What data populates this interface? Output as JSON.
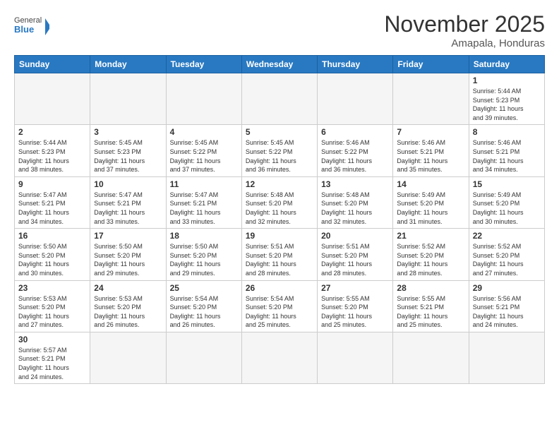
{
  "header": {
    "logo_general": "General",
    "logo_blue": "Blue",
    "month_title": "November 2025",
    "location": "Amapala, Honduras"
  },
  "days_of_week": [
    "Sunday",
    "Monday",
    "Tuesday",
    "Wednesday",
    "Thursday",
    "Friday",
    "Saturday"
  ],
  "weeks": [
    [
      {
        "day": "",
        "info": ""
      },
      {
        "day": "",
        "info": ""
      },
      {
        "day": "",
        "info": ""
      },
      {
        "day": "",
        "info": ""
      },
      {
        "day": "",
        "info": ""
      },
      {
        "day": "",
        "info": ""
      },
      {
        "day": "1",
        "info": "Sunrise: 5:44 AM\nSunset: 5:23 PM\nDaylight: 11 hours\nand 39 minutes."
      }
    ],
    [
      {
        "day": "2",
        "info": "Sunrise: 5:44 AM\nSunset: 5:23 PM\nDaylight: 11 hours\nand 38 minutes."
      },
      {
        "day": "3",
        "info": "Sunrise: 5:45 AM\nSunset: 5:23 PM\nDaylight: 11 hours\nand 37 minutes."
      },
      {
        "day": "4",
        "info": "Sunrise: 5:45 AM\nSunset: 5:22 PM\nDaylight: 11 hours\nand 37 minutes."
      },
      {
        "day": "5",
        "info": "Sunrise: 5:45 AM\nSunset: 5:22 PM\nDaylight: 11 hours\nand 36 minutes."
      },
      {
        "day": "6",
        "info": "Sunrise: 5:46 AM\nSunset: 5:22 PM\nDaylight: 11 hours\nand 36 minutes."
      },
      {
        "day": "7",
        "info": "Sunrise: 5:46 AM\nSunset: 5:21 PM\nDaylight: 11 hours\nand 35 minutes."
      },
      {
        "day": "8",
        "info": "Sunrise: 5:46 AM\nSunset: 5:21 PM\nDaylight: 11 hours\nand 34 minutes."
      }
    ],
    [
      {
        "day": "9",
        "info": "Sunrise: 5:47 AM\nSunset: 5:21 PM\nDaylight: 11 hours\nand 34 minutes."
      },
      {
        "day": "10",
        "info": "Sunrise: 5:47 AM\nSunset: 5:21 PM\nDaylight: 11 hours\nand 33 minutes."
      },
      {
        "day": "11",
        "info": "Sunrise: 5:47 AM\nSunset: 5:21 PM\nDaylight: 11 hours\nand 33 minutes."
      },
      {
        "day": "12",
        "info": "Sunrise: 5:48 AM\nSunset: 5:20 PM\nDaylight: 11 hours\nand 32 minutes."
      },
      {
        "day": "13",
        "info": "Sunrise: 5:48 AM\nSunset: 5:20 PM\nDaylight: 11 hours\nand 32 minutes."
      },
      {
        "day": "14",
        "info": "Sunrise: 5:49 AM\nSunset: 5:20 PM\nDaylight: 11 hours\nand 31 minutes."
      },
      {
        "day": "15",
        "info": "Sunrise: 5:49 AM\nSunset: 5:20 PM\nDaylight: 11 hours\nand 30 minutes."
      }
    ],
    [
      {
        "day": "16",
        "info": "Sunrise: 5:50 AM\nSunset: 5:20 PM\nDaylight: 11 hours\nand 30 minutes."
      },
      {
        "day": "17",
        "info": "Sunrise: 5:50 AM\nSunset: 5:20 PM\nDaylight: 11 hours\nand 29 minutes."
      },
      {
        "day": "18",
        "info": "Sunrise: 5:50 AM\nSunset: 5:20 PM\nDaylight: 11 hours\nand 29 minutes."
      },
      {
        "day": "19",
        "info": "Sunrise: 5:51 AM\nSunset: 5:20 PM\nDaylight: 11 hours\nand 28 minutes."
      },
      {
        "day": "20",
        "info": "Sunrise: 5:51 AM\nSunset: 5:20 PM\nDaylight: 11 hours\nand 28 minutes."
      },
      {
        "day": "21",
        "info": "Sunrise: 5:52 AM\nSunset: 5:20 PM\nDaylight: 11 hours\nand 28 minutes."
      },
      {
        "day": "22",
        "info": "Sunrise: 5:52 AM\nSunset: 5:20 PM\nDaylight: 11 hours\nand 27 minutes."
      }
    ],
    [
      {
        "day": "23",
        "info": "Sunrise: 5:53 AM\nSunset: 5:20 PM\nDaylight: 11 hours\nand 27 minutes."
      },
      {
        "day": "24",
        "info": "Sunrise: 5:53 AM\nSunset: 5:20 PM\nDaylight: 11 hours\nand 26 minutes."
      },
      {
        "day": "25",
        "info": "Sunrise: 5:54 AM\nSunset: 5:20 PM\nDaylight: 11 hours\nand 26 minutes."
      },
      {
        "day": "26",
        "info": "Sunrise: 5:54 AM\nSunset: 5:20 PM\nDaylight: 11 hours\nand 25 minutes."
      },
      {
        "day": "27",
        "info": "Sunrise: 5:55 AM\nSunset: 5:20 PM\nDaylight: 11 hours\nand 25 minutes."
      },
      {
        "day": "28",
        "info": "Sunrise: 5:55 AM\nSunset: 5:21 PM\nDaylight: 11 hours\nand 25 minutes."
      },
      {
        "day": "29",
        "info": "Sunrise: 5:56 AM\nSunset: 5:21 PM\nDaylight: 11 hours\nand 24 minutes."
      }
    ],
    [
      {
        "day": "30",
        "info": "Sunrise: 5:57 AM\nSunset: 5:21 PM\nDaylight: 11 hours\nand 24 minutes."
      },
      {
        "day": "",
        "info": ""
      },
      {
        "day": "",
        "info": ""
      },
      {
        "day": "",
        "info": ""
      },
      {
        "day": "",
        "info": ""
      },
      {
        "day": "",
        "info": ""
      },
      {
        "day": "",
        "info": ""
      }
    ]
  ]
}
